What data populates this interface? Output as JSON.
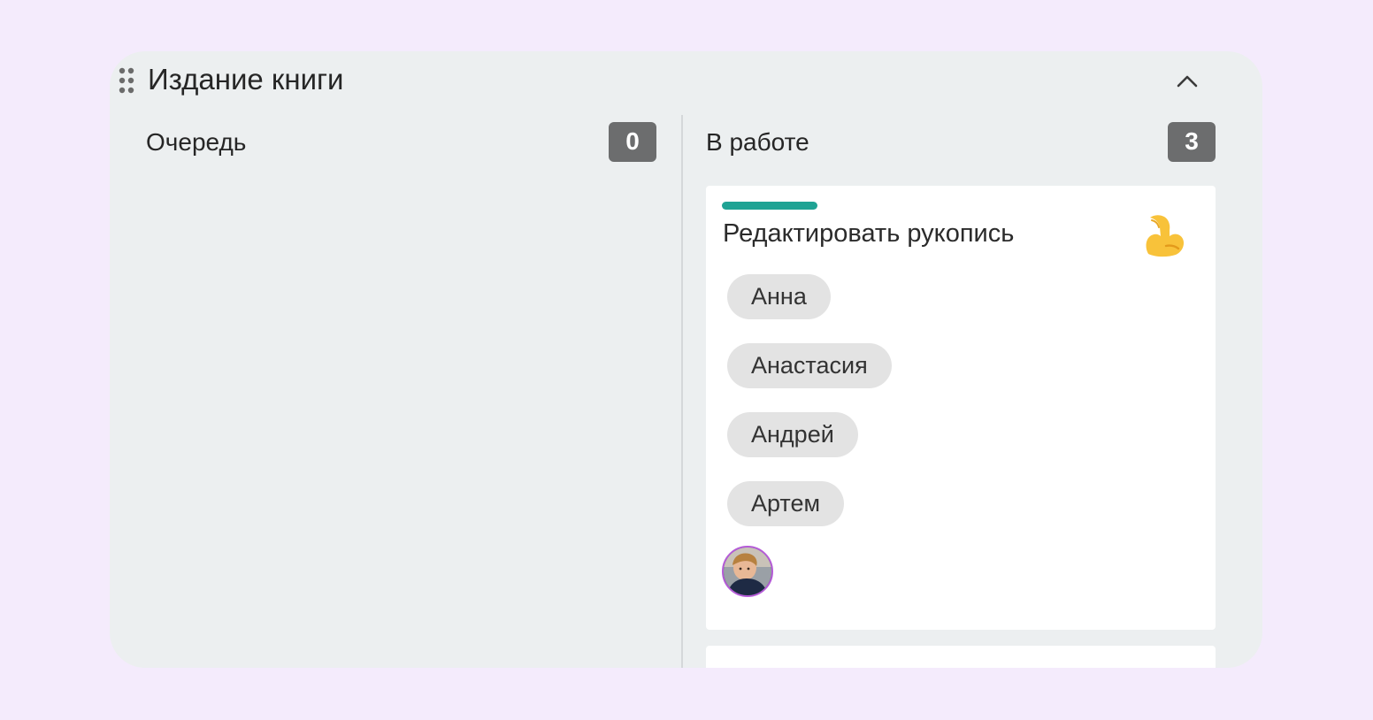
{
  "board": {
    "title": "Издание книги",
    "handle_icon": "drag-handle-icon",
    "collapse_icon": "chevron-up-icon"
  },
  "columns": [
    {
      "title": "Очередь",
      "count": "0"
    },
    {
      "title": "В работе",
      "count": "3"
    }
  ],
  "card": {
    "title": "Редактировать рукопись",
    "stripe_color": "#1fa394",
    "emoji": "💪",
    "emoji_icon": "flexed-biceps-icon",
    "tags": [
      "Анна",
      "Анастасия",
      "Андрей",
      "Артем"
    ],
    "avatar_icon": "user-avatar"
  },
  "colors": {
    "page_background": "#f4ebfc",
    "board_background": "#eceff0",
    "badge_background": "#6c6d6e",
    "tag_background": "#e3e3e3",
    "avatar_border": "#b55bd8"
  }
}
